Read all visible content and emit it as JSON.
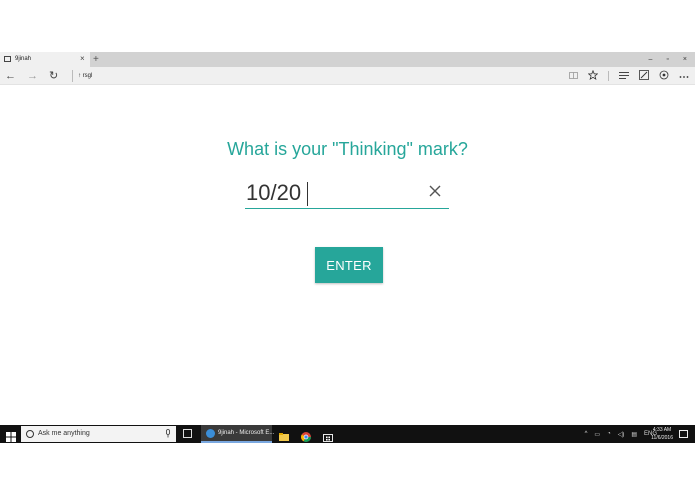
{
  "browser": {
    "tab_title": "9jinah",
    "tab_close": "×",
    "new_tab": "+",
    "window_controls": [
      "–",
      "▫",
      "×"
    ],
    "address": "↑ rsgl",
    "nav": {
      "back": "←",
      "forward": "→",
      "refresh": "↻"
    },
    "toolbar_icons": [
      "reading-view-icon",
      "favorite-star-icon",
      "hub-icon",
      "web-note-icon",
      "share-icon",
      "more-icon"
    ]
  },
  "page": {
    "question": "What is your \"Thinking\" mark?",
    "input_value": "10/20",
    "clear_icon": "close-icon",
    "enter_label": "ENTER",
    "accent_color": "#26a69a"
  },
  "taskbar": {
    "search_placeholder": "Ask me anything",
    "edge_task_title": "9jinah - Microsoft E...",
    "language": "ENG",
    "time": "4:33 AM",
    "date": "11/6/2016"
  }
}
